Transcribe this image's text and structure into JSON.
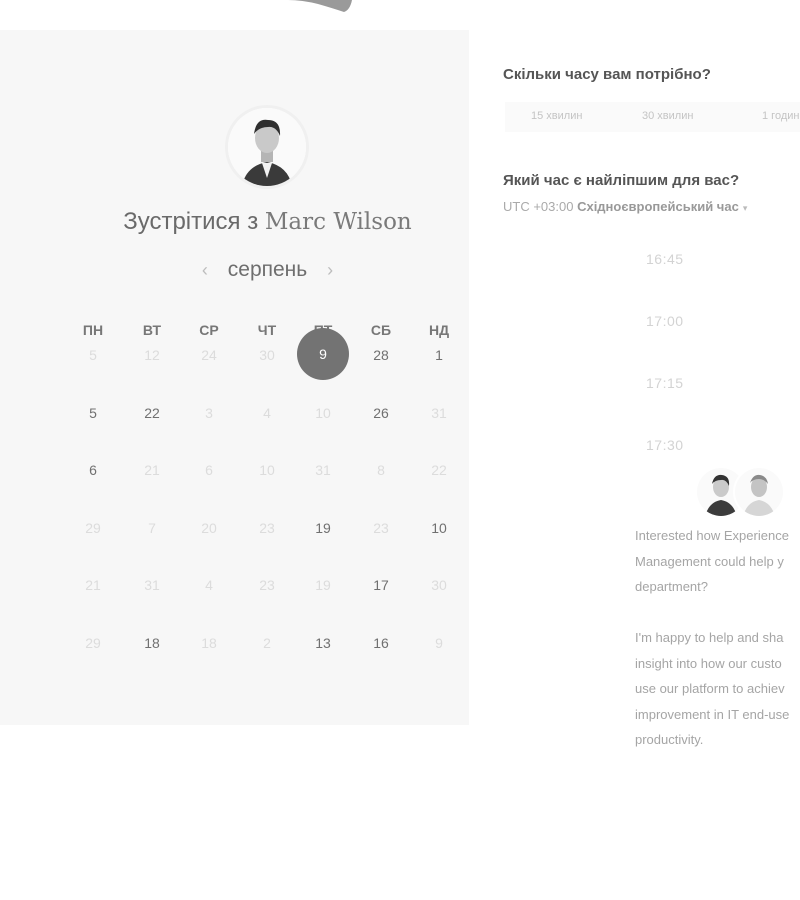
{
  "host": {
    "prefix": "Зустрітися з ",
    "name": "Marc Wilson"
  },
  "calendar": {
    "month": "серпень",
    "prev_icon": "‹",
    "next_icon": "›",
    "weekdays": [
      "ПН",
      "ВТ",
      "СР",
      "ЧТ",
      "ПТ",
      "СБ",
      "НД"
    ],
    "selected": "9",
    "rows": [
      [
        {
          "d": "5",
          "on": false
        },
        {
          "d": "12",
          "on": false
        },
        {
          "d": "24",
          "on": false
        },
        {
          "d": "30",
          "on": false
        },
        {
          "d": "",
          "on": false
        },
        {
          "d": "28",
          "on": true
        },
        {
          "d": "1",
          "on": true
        }
      ],
      [
        {
          "d": "5",
          "on": true
        },
        {
          "d": "22",
          "on": true
        },
        {
          "d": "3",
          "on": false
        },
        {
          "d": "4",
          "on": false
        },
        {
          "d": "10",
          "on": false
        },
        {
          "d": "26",
          "on": true
        },
        {
          "d": "31",
          "on": false
        }
      ],
      [
        {
          "d": "6",
          "on": true
        },
        {
          "d": "21",
          "on": false
        },
        {
          "d": "6",
          "on": false
        },
        {
          "d": "10",
          "on": false
        },
        {
          "d": "31",
          "on": false
        },
        {
          "d": "8",
          "on": false
        },
        {
          "d": "22",
          "on": false
        }
      ],
      [
        {
          "d": "29",
          "on": false
        },
        {
          "d": "7",
          "on": false
        },
        {
          "d": "20",
          "on": false
        },
        {
          "d": "23",
          "on": false
        },
        {
          "d": "19",
          "on": true
        },
        {
          "d": "23",
          "on": false
        },
        {
          "d": "10",
          "on": true
        }
      ],
      [
        {
          "d": "21",
          "on": false
        },
        {
          "d": "31",
          "on": false
        },
        {
          "d": "4",
          "on": false
        },
        {
          "d": "23",
          "on": false
        },
        {
          "d": "19",
          "on": false
        },
        {
          "d": "17",
          "on": true
        },
        {
          "d": "30",
          "on": false
        }
      ],
      [
        {
          "d": "29",
          "on": false
        },
        {
          "d": "18",
          "on": true
        },
        {
          "d": "18",
          "on": false
        },
        {
          "d": "2",
          "on": false
        },
        {
          "d": "13",
          "on": true
        },
        {
          "d": "16",
          "on": true
        },
        {
          "d": "9",
          "on": false
        }
      ]
    ]
  },
  "duration": {
    "title": "Скільки часу вам потрібно?",
    "options": [
      "15 хвилин",
      "30 хвилин",
      "1 годин"
    ]
  },
  "time": {
    "title": "Який час є найліпшим для вас?",
    "tz_offset": "UTC +03:00",
    "tz_name": "Східноєвропейський час",
    "caret": "▾",
    "slots": [
      "16:45",
      "17:00",
      "17:15",
      "17:30"
    ]
  },
  "message": {
    "lines": [
      "Interested how Experience",
      "Management could help y",
      "department?",
      "",
      "I'm happy to help and sha",
      "insight into how our custo",
      "use our platform to achiev",
      "improvement in IT end-use",
      "productivity."
    ]
  },
  "icons": {
    "prev": "chevron-left-icon",
    "next": "chevron-right-icon",
    "tz": "chevron-down-icon"
  }
}
